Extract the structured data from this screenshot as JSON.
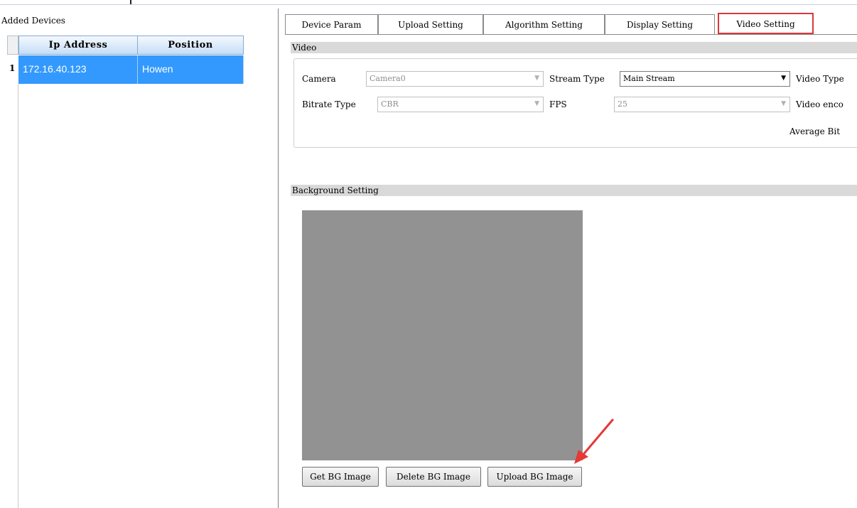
{
  "left_panel": {
    "title": "Added Devices",
    "columns": [
      "Ip Address",
      "Position"
    ],
    "rows": [
      {
        "num": "1",
        "ip": "172.16.40.123",
        "position": "Howen"
      }
    ]
  },
  "tabs": [
    {
      "label": "Device Param",
      "active": false
    },
    {
      "label": "Upload Setting",
      "active": false
    },
    {
      "label": "Algorithm Setting",
      "active": false
    },
    {
      "label": "Display Setting",
      "active": false
    },
    {
      "label": "Video Setting",
      "active": true
    }
  ],
  "video_section": {
    "title": "Video",
    "camera_label": "Camera",
    "camera_value": "Camera0",
    "stream_type_label": "Stream Type",
    "stream_type_value": "Main Stream",
    "video_type_label": "Video Type",
    "bitrate_type_label": "Bitrate Type",
    "bitrate_type_value": "CBR",
    "fps_label": "FPS",
    "fps_value": "25",
    "video_encoding_label": "Video enco",
    "average_bitrate_label": "Average Bit"
  },
  "background_section": {
    "title": "Background Setting",
    "get_button": "Get BG Image",
    "delete_button": "Delete BG Image",
    "upload_button": "Upload BG Image"
  },
  "colors": {
    "selection": "#3399ff",
    "highlight_border": "#d9383a",
    "bg_image": "#929292",
    "annotation_arrow": "#e53935"
  }
}
